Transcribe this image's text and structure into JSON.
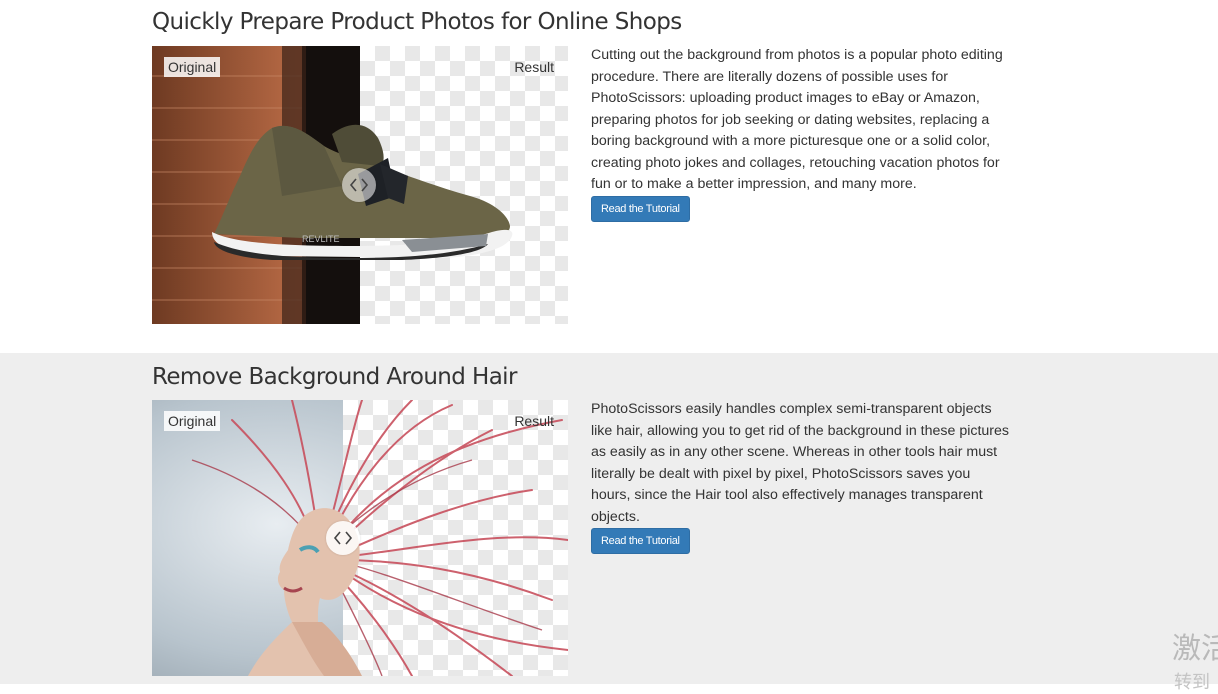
{
  "sections": [
    {
      "title": "Quickly Prepare Product Photos for Online Shops",
      "compare": {
        "original_label": "Original",
        "result_label": "Result",
        "slider_split": 0.5
      },
      "description": "Cutting out the background from photos is a popular photo editing procedure. There are literally dozens of possible uses for PhotoScissors: uploading product images to eBay or Amazon, preparing photos for job seeking or dating websites, replacing a boring background with a more picturesque one or a solid color, creating photo jokes and collages, retouching vacation photos for fun or to make a better impression, and many more.",
      "button_label": "Read the Tutorial"
    },
    {
      "title": "Remove Background Around Hair",
      "compare": {
        "original_label": "Original",
        "result_label": "Result",
        "slider_split": 0.46
      },
      "description": "PhotoScissors easily handles complex semi-transparent objects like hair, allowing you to get rid of the background in these pictures as easily as in any other scene. Whereas in other tools hair must literally be dealt with pixel by pixel, PhotoScissors saves you hours, since the Hair tool also effectively manages transparent objects.",
      "button_label": "Read the Tutorial"
    }
  ],
  "colors": {
    "button": "#337ab7",
    "alt_section_bg": "#eeeeee"
  },
  "watermark": {
    "line1": "激活",
    "line2": "转到"
  }
}
